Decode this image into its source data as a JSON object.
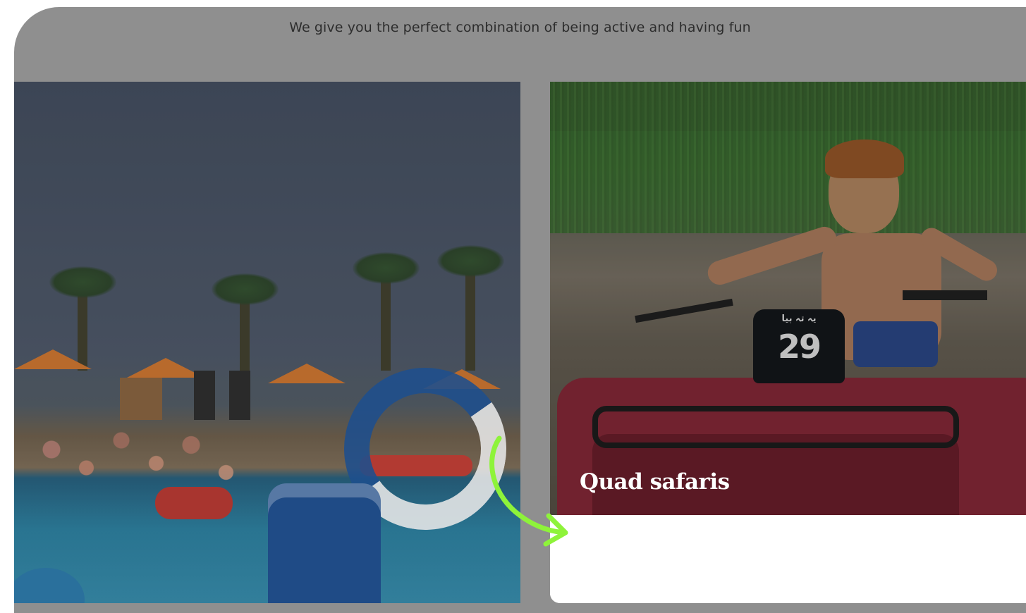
{
  "section": {
    "tagline": "We give you the perfect combination of being active and having fun"
  },
  "cards": [
    {
      "title": "",
      "image": "pool-water-park-photo"
    },
    {
      "title": "Quad safaris",
      "image": "quad-bike-photo",
      "plate_number": "29",
      "plate_text": "یہ تہ بیا"
    }
  ],
  "colors": {
    "page_background": "#ffffff",
    "overlay": "#8f8f8f",
    "card_background": "#ffffff",
    "arrow_accent": "#8ef33a"
  },
  "icons": {
    "pointer": "curved-arrow-icon"
  }
}
